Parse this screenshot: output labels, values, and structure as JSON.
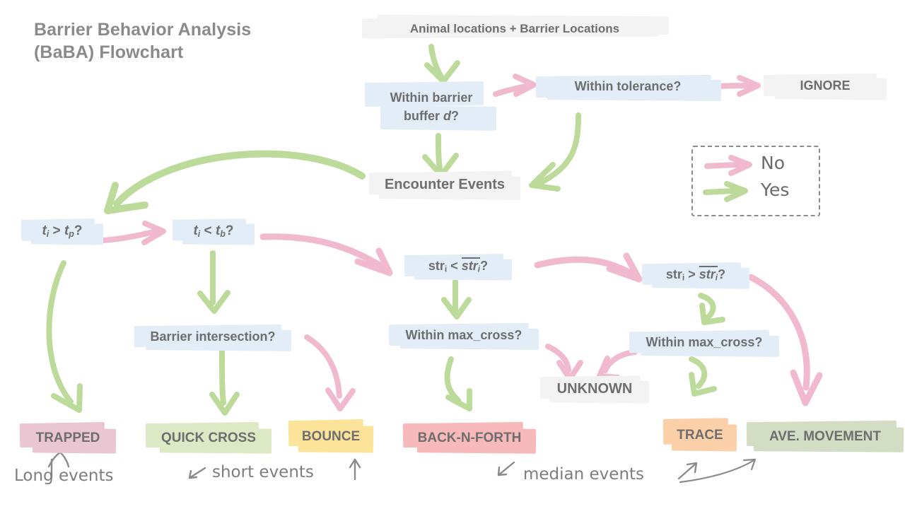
{
  "title": {
    "line1": "Barrier Behavior Analysis",
    "line2": "(BaBA) Flowchart"
  },
  "nodes": {
    "input": {
      "label": "Animal locations + Barrier Locations",
      "style": "gray"
    },
    "within_buffer_l1": {
      "label": "Within barrier",
      "style": "blue"
    },
    "within_buffer_l2": {
      "label": "buffer d?",
      "style": "blue"
    },
    "within_tolerance": {
      "label": "Within tolerance?",
      "style": "blue"
    },
    "ignore": {
      "label": "IGNORE",
      "style": "gray"
    },
    "encounter_events": {
      "label": "Encounter Events",
      "style": "gray"
    },
    "t_gt_tp": {
      "label": "ti > tp?",
      "style": "blue"
    },
    "t_lt_tb": {
      "label": "ti < tb?",
      "style": "blue"
    },
    "str_lt": {
      "label": "stri < stri?",
      "style": "blue"
    },
    "str_gt": {
      "label": "stri > stri?",
      "style": "blue"
    },
    "barrier_intersection": {
      "label": "Barrier intersection?",
      "style": "blue"
    },
    "within_max_cross_left": {
      "label": "Within max_cross?",
      "style": "blue"
    },
    "within_max_cross_right": {
      "label": "Within max_cross?",
      "style": "blue"
    },
    "unknown": {
      "label": "UNKNOWN",
      "style": "gray"
    }
  },
  "outcomes": {
    "trapped": {
      "label": "TRAPPED",
      "style": "pink",
      "color": "#e9c6d2"
    },
    "quick_cross": {
      "label": "QUICK CROSS",
      "style": "green",
      "color": "#dde8c4"
    },
    "bounce": {
      "label": "BOUNCE",
      "style": "yellow",
      "color": "#fbe49a"
    },
    "back_n_forth": {
      "label": "BACK-N-FORTH",
      "style": "salmon",
      "color": "#f7b9b9"
    },
    "trace": {
      "label": "TRACE",
      "style": "orange",
      "color": "#fbd0a8"
    },
    "ave_movement": {
      "label": "AVE. MOVEMENT",
      "style": "sage",
      "color": "#d3ddc4"
    }
  },
  "legend": {
    "no_label": "No",
    "yes_label": "Yes",
    "no_color": "#f0b9cd",
    "yes_color": "#bcdb9b"
  },
  "annotations": {
    "long_events": "Long events",
    "short_events": "short events",
    "median_events": "median events"
  },
  "colors": {
    "text": "#6e6e6e",
    "title": "#8a8a8a",
    "yes_arrow": "#bcdb9b",
    "no_arrow": "#f0b9cd",
    "node_fill_blue": "#e3edf7",
    "node_fill_gray": "#f3f3f3",
    "background": "#ffffff"
  }
}
